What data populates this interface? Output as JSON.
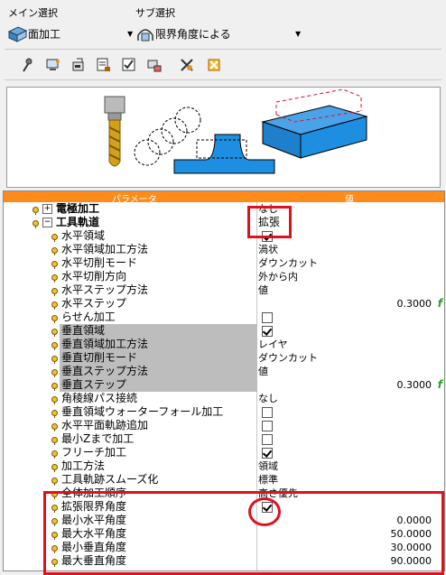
{
  "main_select": {
    "label": "メイン選択",
    "value": "面加工"
  },
  "sub_select": {
    "label": "サブ選択",
    "value": "限界角度による"
  },
  "toolbar_icons": [
    "probe-icon",
    "computer-icon",
    "export-icon",
    "plot-icon",
    "checklist-icon",
    "tool-icon",
    "settings-icon",
    "close-icon"
  ],
  "grid": {
    "header_param": "パラメータ",
    "header_value": "値",
    "rows": [
      {
        "name": "電極加工",
        "value": "なし",
        "bold": true,
        "expander": "+",
        "level": 0
      },
      {
        "name": "工具軌道",
        "value": "拡張",
        "bold": true,
        "expander": "−",
        "level": 0
      },
      {
        "name": "水平領域",
        "check": true,
        "level": 1
      },
      {
        "name": "水平領域加工方法",
        "value": "渦状",
        "level": 1
      },
      {
        "name": "水平切削モード",
        "value": "ダウンカット",
        "level": 1
      },
      {
        "name": "水平切削方向",
        "value": "外から内",
        "level": 1
      },
      {
        "name": "水平ステップ方法",
        "value": "値",
        "level": 1
      },
      {
        "name": "水平ステップ",
        "num": "0.3000",
        "fx": "f",
        "level": 1
      },
      {
        "name": "らせん加工",
        "check": false,
        "level": 1
      },
      {
        "name": "垂直領域",
        "check": true,
        "level": 1,
        "gray": true
      },
      {
        "name": "垂直領域加工方法",
        "value": "レイヤ",
        "level": 1,
        "gray": true
      },
      {
        "name": "垂直切削モード",
        "value": "ダウンカット",
        "level": 1,
        "gray": true
      },
      {
        "name": "垂直ステップ方法",
        "value": "値",
        "level": 1,
        "gray": true
      },
      {
        "name": "垂直ステップ",
        "num": "0.3000",
        "fx": "f",
        "level": 1,
        "gray": true
      },
      {
        "name": "角稜線パス接続",
        "value": "なし",
        "level": 1
      },
      {
        "name": "垂直領域ウォーターフォール加工",
        "check": false,
        "level": 1
      },
      {
        "name": "水平平面軌跡追加",
        "check": false,
        "level": 1
      },
      {
        "name": "最小Zまで加工",
        "check": false,
        "level": 1
      },
      {
        "name": "フリーチ加工",
        "check": true,
        "level": 1
      },
      {
        "name": "加工方法",
        "value": "領域",
        "level": 1
      },
      {
        "name": "工具軌跡スムーズ化",
        "value": "標準",
        "level": 1
      },
      {
        "name": "全体加工順序",
        "value": "高さ優先",
        "level": 1
      },
      {
        "name": "拡張限界角度",
        "check": true,
        "level": 1
      },
      {
        "name": "最小水平角度",
        "num": "0.0000",
        "level": 1
      },
      {
        "name": "最大水平角度",
        "num": "50.0000",
        "level": 1
      },
      {
        "name": "最小垂直角度",
        "num": "30.0000",
        "level": 1
      },
      {
        "name": "最大垂直角度",
        "num": "90.0000",
        "level": 1
      }
    ]
  },
  "colors": {
    "accent_orange": "#ff8c1a",
    "highlight_red": "#e0101e",
    "part_blue": "#1e8fe0"
  }
}
